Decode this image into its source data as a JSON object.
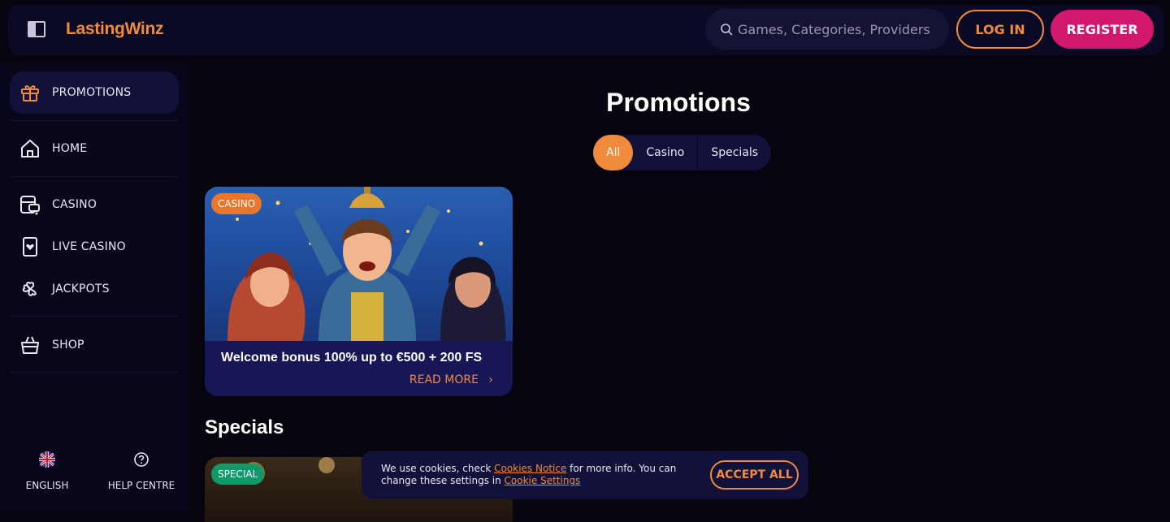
{
  "header": {
    "logo": "LastingWinz",
    "search_placeholder": "Games, Categories, Providers",
    "login_label": "LOG IN",
    "register_label": "REGISTER"
  },
  "sidebar": {
    "items": [
      {
        "label": "PROMOTIONS",
        "icon": "gift-icon",
        "active": true
      },
      {
        "label": "HOME",
        "icon": "home-icon"
      },
      {
        "label": "CASINO",
        "icon": "slot-machine-icon"
      },
      {
        "label": "LIVE CASINO",
        "icon": "card-icon"
      },
      {
        "label": "JACKPOTS",
        "icon": "clover-icon"
      },
      {
        "label": "SHOP",
        "icon": "basket-icon"
      }
    ],
    "language_label": "ENGLISH",
    "help_label": "HELP CENTRE"
  },
  "main": {
    "title": "Promotions",
    "filters": [
      "All",
      "Casino",
      "Specials"
    ],
    "active_filter": "All",
    "promo_card": {
      "badge": "CASINO",
      "title": "Welcome bonus 100% up to €500 + 200 FS",
      "read_more": "READ MORE"
    },
    "specials_title": "Specials",
    "special_card": {
      "badge": "SPECIAL"
    }
  },
  "cookie": {
    "text_1": "We use cookies, check ",
    "link_1": "Cookies Notice",
    "text_2": " for more info. You can change these settings in ",
    "link_2": "Cookie Settings",
    "accept_label": "ACCEPT ALL"
  },
  "colors": {
    "accent": "#f08a3c",
    "register": "#d2186e",
    "background": "#05040f",
    "panel": "#0b0a24"
  }
}
